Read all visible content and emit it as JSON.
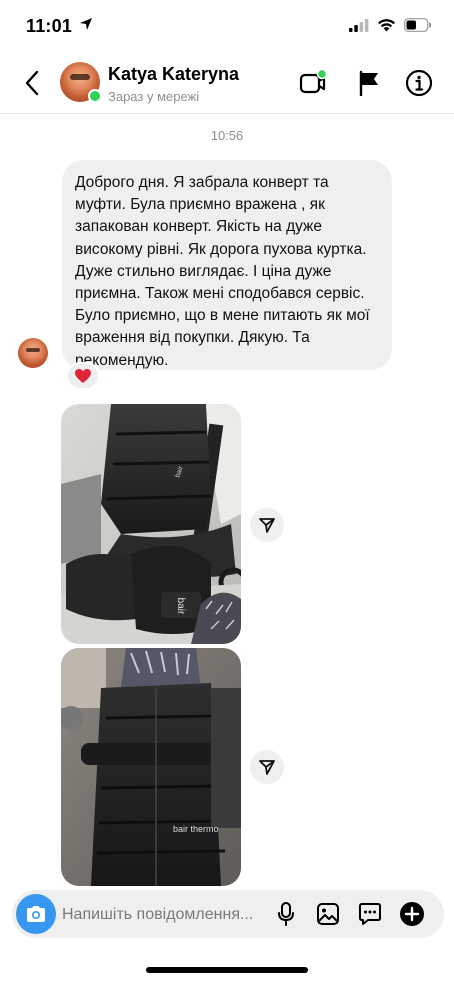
{
  "status_bar": {
    "time": "11:01"
  },
  "header": {
    "contact_name": "Katya Kateryna",
    "contact_status": "Зараз у мережі"
  },
  "chat": {
    "timestamp": "10:56",
    "messages": [
      {
        "text": "Доброго дня. Я забрала конверт та муфти. Була приємно вражена , як запакован конверт. Якість на дуже високому рівні. Як дорога пухова куртка. Дуже стильно виглядає. І ціна дуже приємна. Також мені сподобався сервіс. Було приємно, що в мене питають як мої враження від покупки. Дякую. Та рекомендую.",
        "reaction": "❤️"
      }
    ],
    "photo_labels": [
      "bair",
      "bair",
      "bair thermo"
    ]
  },
  "composer": {
    "placeholder": "Напишіть повідомлення..."
  },
  "colors": {
    "accent": "#3797f0",
    "online": "#2fd157",
    "bubble": "#efefef"
  }
}
